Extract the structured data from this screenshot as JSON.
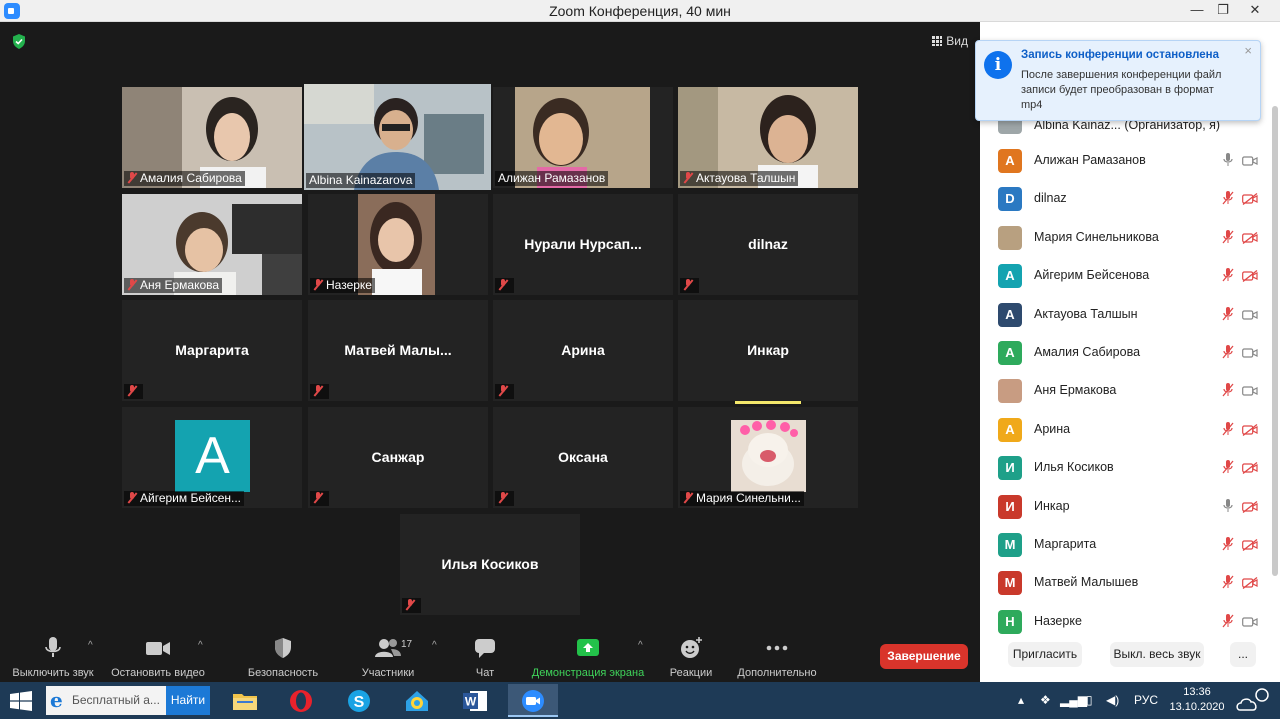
{
  "window": {
    "title": "Zoom Конференция, 40 мин",
    "minimize": "—",
    "maximize": "❐",
    "close": "✕"
  },
  "meeting": {
    "view_label": "Вид",
    "tiles": [
      {
        "name": "Амалия Сабирова",
        "type": "video"
      },
      {
        "name": "Albina Kainazarova",
        "type": "video",
        "active": true
      },
      {
        "name": "Алижан Рамазанов",
        "type": "video"
      },
      {
        "name": "Актауова Талшын",
        "type": "video"
      },
      {
        "name": "Аня Ермакова",
        "type": "video"
      },
      {
        "name": "Назерке",
        "type": "video"
      },
      {
        "name": "Нурали  Нурсап...",
        "type": "name"
      },
      {
        "name": "dilnaz",
        "type": "name"
      },
      {
        "name": "Маргарита",
        "type": "name"
      },
      {
        "name": "Матвей  Малы...",
        "type": "name"
      },
      {
        "name": "Арина",
        "type": "name"
      },
      {
        "name": "Инкар",
        "type": "name"
      },
      {
        "name": "Айгерим Бейсен...",
        "type": "avatar",
        "letter": "A"
      },
      {
        "name": "Санжар",
        "type": "name"
      },
      {
        "name": "Оксана",
        "type": "name"
      },
      {
        "name": "Мария Синельни...",
        "type": "photo"
      },
      {
        "name": "Илья Косиков",
        "type": "name"
      }
    ]
  },
  "toolbar": {
    "mute": "Выключить звук",
    "video": "Остановить видео",
    "security": "Безопасность",
    "participants": "Участники",
    "participants_count": "17",
    "chat": "Чат",
    "share": "Демонстрация экрана",
    "reactions": "Реакции",
    "more": "Дополнительно",
    "end": "Завершение",
    "caret": "^"
  },
  "notification": {
    "title": "Запись конференции остановлена",
    "body": "После завершения конференции файл записи будет преобразован в формат mp4",
    "icon": "i",
    "close": "×"
  },
  "participants_panel": {
    "first_row": "Albina Kainaz...  (Организатор, я)",
    "items": [
      {
        "letter": "А",
        "name": "Алижан Рамазанов",
        "color": "#e0761f",
        "mic": "on",
        "cam": "on"
      },
      {
        "letter": "D",
        "name": "dilnaz",
        "color": "#2b79c2",
        "mic": "off",
        "cam": "off"
      },
      {
        "letter": "",
        "name": "Мария Синельникова",
        "color": "#b8a080",
        "mic": "off",
        "cam": "off"
      },
      {
        "letter": "A",
        "name": "Айгерим Бейсенова",
        "color": "#14a3b0",
        "mic": "off",
        "cam": "off"
      },
      {
        "letter": "А",
        "name": "Актауова Талшын",
        "color": "#2e4a6e",
        "mic": "off",
        "cam": "on"
      },
      {
        "letter": "А",
        "name": "Амалия Сабирова",
        "color": "#2eaa5c",
        "mic": "off",
        "cam": "on"
      },
      {
        "letter": "",
        "name": "Аня Ермакова",
        "color": "#c89c82",
        "mic": "off",
        "cam": "on"
      },
      {
        "letter": "А",
        "name": "Арина",
        "color": "#f0a91a",
        "mic": "off",
        "cam": "off"
      },
      {
        "letter": "И",
        "name": "Илья Косиков",
        "color": "#1ea089",
        "mic": "off",
        "cam": "off"
      },
      {
        "letter": "И",
        "name": "Инкар",
        "color": "#c9392b",
        "mic": "on",
        "cam": "off"
      },
      {
        "letter": "М",
        "name": "Маргарита",
        "color": "#1ea089",
        "mic": "off",
        "cam": "off"
      },
      {
        "letter": "М",
        "name": "Матвей Малышев",
        "color": "#c9392b",
        "mic": "off",
        "cam": "off"
      },
      {
        "letter": "Н",
        "name": "Назерке",
        "color": "#2eaa5c",
        "mic": "off",
        "cam": "on"
      }
    ],
    "invite": "Пригласить",
    "mute_all": "Выкл. весь звук",
    "more": "..."
  },
  "taskbar": {
    "search_text": "Бесплатный а...",
    "search_button": "Найти",
    "language": "РУС",
    "time": "13:36",
    "date": "13.10.2020"
  }
}
